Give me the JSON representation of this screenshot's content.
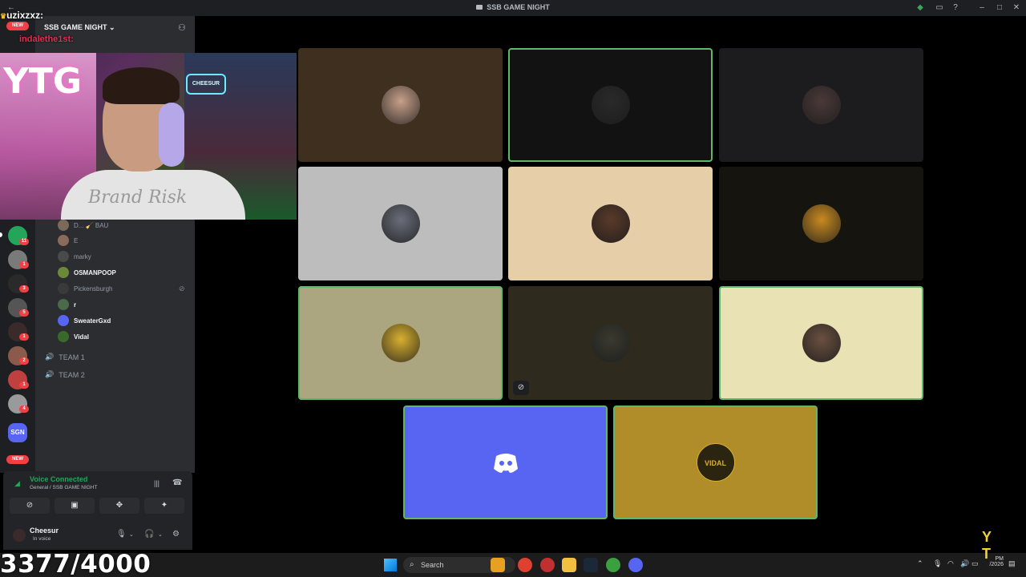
{
  "window": {
    "title": "SSB GAME NIGHT"
  },
  "overlay": {
    "stream_user": "uzixzxz:",
    "chat_user": "indalethe1st:",
    "counter": "3377/4000",
    "webcam_sign": "YTG",
    "webcam_sign2": "CHEESUR",
    "shirt_text": "Brand Risk"
  },
  "sidebar": {
    "server_name": "SSB GAME NIGHT",
    "new_label": "NEW",
    "rail_badges": [
      "11",
      "1",
      "3",
      "5",
      "1",
      "2",
      "1",
      "4"
    ],
    "server_abbrev": "SGN",
    "members": [
      {
        "name": "D... 🧹 BAU",
        "state": "idle",
        "color": "#7a6a5a"
      },
      {
        "name": "E",
        "state": "idle",
        "color": "#8a6a5a"
      },
      {
        "name": "marky",
        "state": "idle",
        "color": "#4a4a4a"
      },
      {
        "name": "OSMANPOOP",
        "state": "active",
        "color": "#6a8a3a"
      },
      {
        "name": "Pickensburgh",
        "state": "idle",
        "color": "#3a3a3a"
      },
      {
        "name": "r",
        "state": "active",
        "color": "#4a6a4a"
      },
      {
        "name": "SweaterGxd",
        "state": "active",
        "color": "#5865f2"
      },
      {
        "name": "Vidal",
        "state": "active",
        "color": "#3a6a2a"
      }
    ],
    "voice_channels": [
      "TEAM 1",
      "TEAM 2"
    ]
  },
  "voice_panel": {
    "status": "Voice Connected",
    "channel": "General / SSB GAME NIGHT",
    "user_name": "Cheesur",
    "user_status": "In voice"
  },
  "grid": {
    "tiles": [
      {
        "bg": "#3e2f1f",
        "speaking": false,
        "avatar": "#c8a08a"
      },
      {
        "bg": "#121212",
        "speaking": true,
        "avatar": "#2a2a2a"
      },
      {
        "bg": "#1c1c1e",
        "speaking": false,
        "avatar": "#4a3a38"
      },
      {
        "bg": "#bdbdbd",
        "speaking": false,
        "avatar": "#6a6e7a"
      },
      {
        "bg": "#e6cfa8",
        "speaking": false,
        "avatar": "#5a3a2a"
      },
      {
        "bg": "#16140f",
        "speaking": false,
        "avatar": "#c88a20"
      },
      {
        "bg": "#aba580",
        "speaking": true,
        "avatar": "#d8b030"
      },
      {
        "bg": "#2e2b1e",
        "speaking": false,
        "avatar": "#3a3a30",
        "muted": true
      },
      {
        "bg": "#e8e2b4",
        "speaking": true,
        "avatar": "#6a5040"
      },
      {
        "bg": "#5865f2",
        "speaking": true,
        "avatar": "discord-logo"
      },
      {
        "bg": "#b08d28",
        "speaking": true,
        "avatar": "#2a2410",
        "avatar_text": "VIDAL"
      }
    ]
  },
  "taskbar": {
    "search_placeholder": "Search",
    "time": "PM",
    "date": "/2026"
  }
}
